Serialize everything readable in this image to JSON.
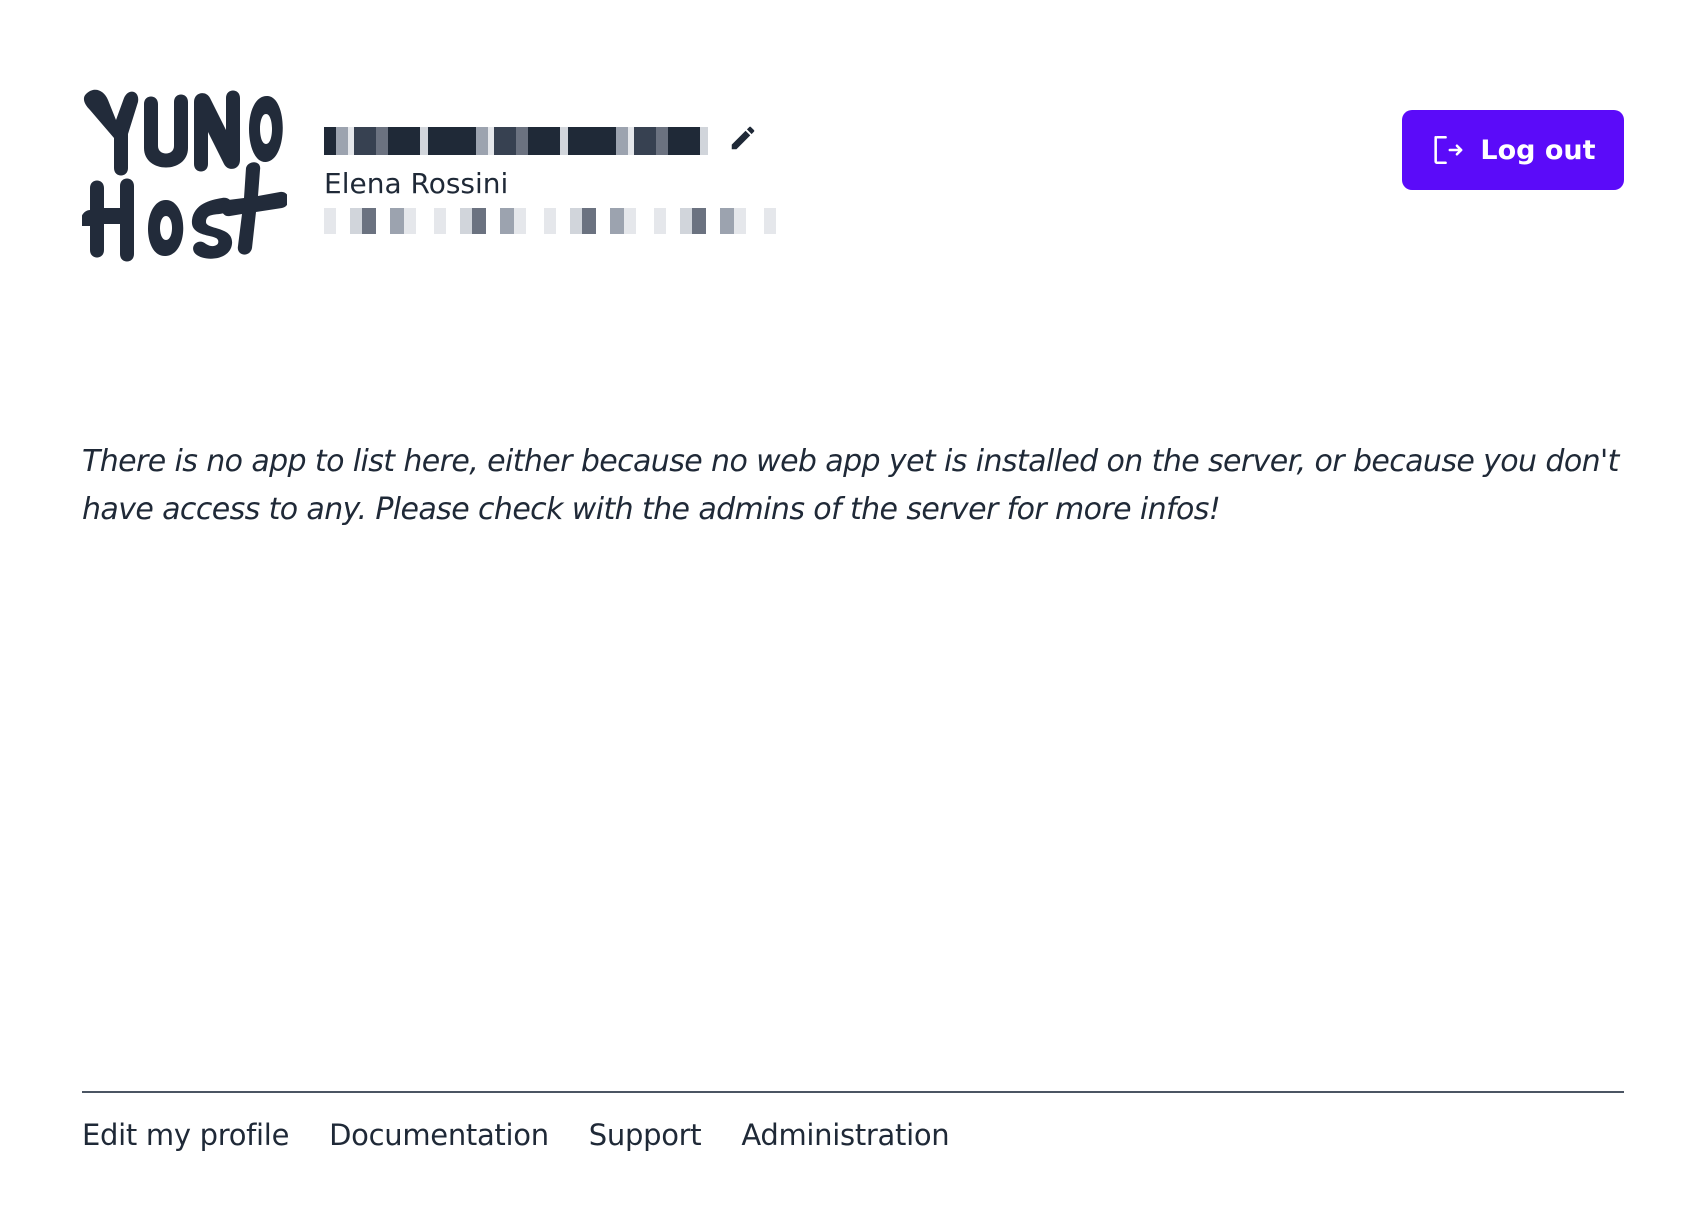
{
  "header": {
    "logo_alt": "YunoHost",
    "username": "██████████████",
    "fullname": "Elena Rossini",
    "email": "████████████████████",
    "edit_icon": "pencil-icon",
    "logout_label": "Log out",
    "logout_icon": "logout-icon"
  },
  "main": {
    "empty_message": "There is no app to list here, either because no web app yet is installed on the server, or because you don't have access to any. Please check with the admins of the server for more infos!"
  },
  "footer": {
    "links": [
      {
        "label": "Edit my profile"
      },
      {
        "label": "Documentation"
      },
      {
        "label": "Support"
      },
      {
        "label": "Administration"
      }
    ]
  },
  "colors": {
    "accent": "#5b0bf9",
    "text": "#1f2937",
    "divider": "#4b5563"
  }
}
